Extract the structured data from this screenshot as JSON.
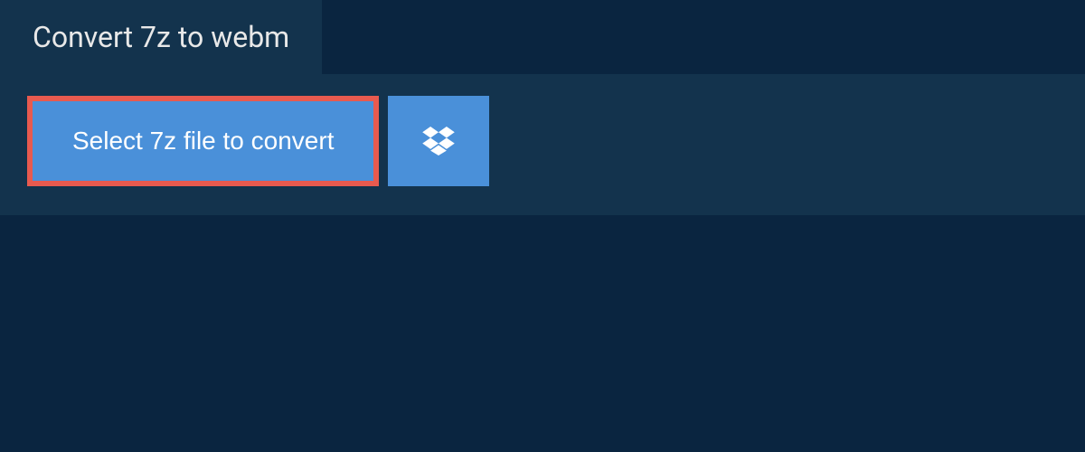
{
  "tab": {
    "title": "Convert 7z to webm"
  },
  "actions": {
    "select_file_label": "Select 7z file to convert"
  },
  "colors": {
    "background": "#0a2540",
    "panel": "#13334d",
    "button": "#4a90d9",
    "highlight_border": "#e85a4f"
  }
}
